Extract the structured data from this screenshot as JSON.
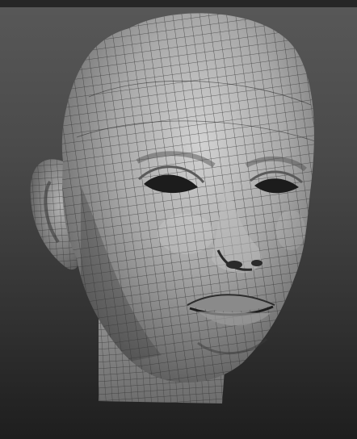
{
  "scene": {
    "subject": "head-mesh",
    "material": "matcap-gray",
    "wireframe": true,
    "background_top": "#585858",
    "background_bottom": "#1e1e1e",
    "mesh_color": "#a9a9a9",
    "wire_color": "#2b2b2b"
  }
}
